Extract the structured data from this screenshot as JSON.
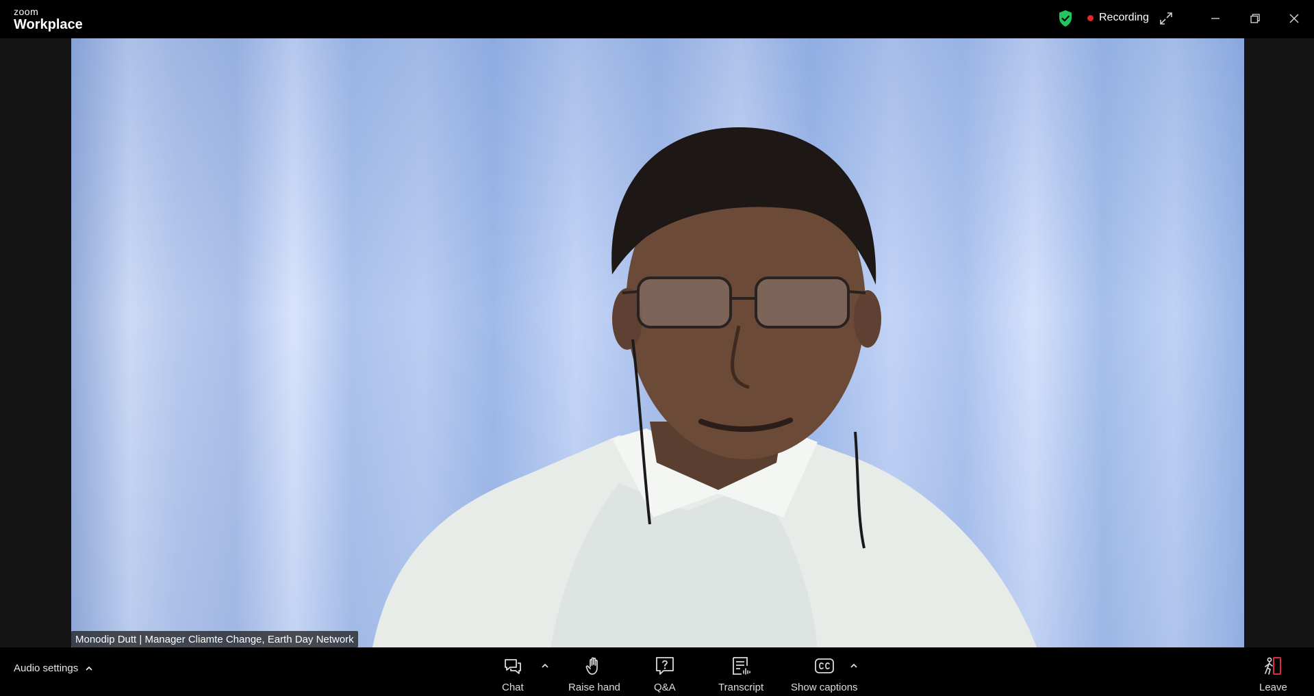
{
  "app": {
    "logo_top": "zoom",
    "logo_bottom": "Workplace",
    "recording_label": "Recording",
    "colors": {
      "shield": "#22c55e",
      "recording_dot": "#e02828",
      "leave_accent": "#e0284a"
    }
  },
  "window_controls": {
    "icons": [
      "minimize-icon",
      "restore-icon",
      "close-icon"
    ]
  },
  "video": {
    "participant_name": "Monodip Dutt | Manager Cliamte Change, Earth Day Network"
  },
  "toolbar": {
    "audio_settings_label": "Audio settings",
    "chat_label": "Chat",
    "raise_hand_label": "Raise hand",
    "qa_label": "Q&A",
    "transcript_label": "Transcript",
    "show_captions_label": "Show captions",
    "leave_label": "Leave"
  }
}
